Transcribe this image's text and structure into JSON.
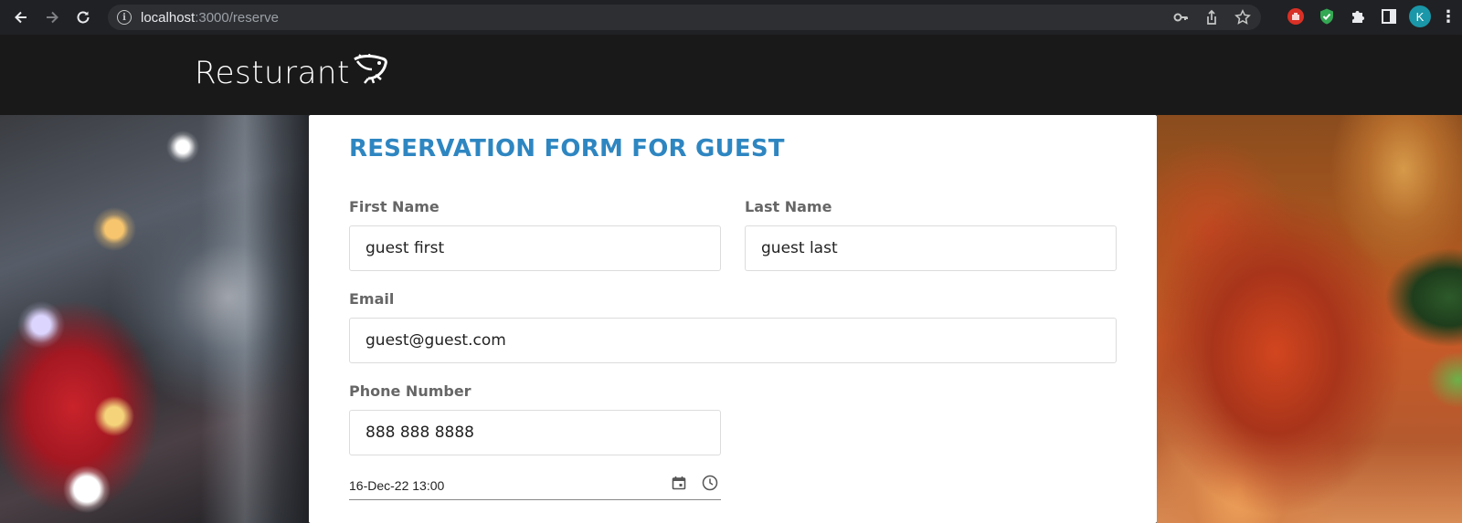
{
  "browser": {
    "url_host": "localhost",
    "url_path": ":3000/reserve",
    "profile_initial": "K",
    "icons": [
      "back-arrow-icon",
      "forward-arrow-icon",
      "reload-icon",
      "site-info-icon",
      "key-icon",
      "share-icon",
      "star-icon",
      "extension-stop-icon",
      "extension-shield-icon",
      "puzzle-icon",
      "sidebar-icon",
      "more-icon"
    ]
  },
  "header": {
    "logo_text": "Resturant"
  },
  "form": {
    "title": "RESERVATION FORM FOR GUEST",
    "first_name": {
      "label": "First Name",
      "value": "guest first"
    },
    "last_name": {
      "label": "Last Name",
      "value": "guest last"
    },
    "email": {
      "label": "Email",
      "value": "guest@guest.com"
    },
    "phone": {
      "label": "Phone Number",
      "value": "888 888 8888"
    },
    "datetime": {
      "value": "16-Dec-22 13:00"
    }
  },
  "colors": {
    "title_accent": "#2e86c1",
    "header_bg": "#1a1919",
    "chrome_bg": "#202124"
  }
}
